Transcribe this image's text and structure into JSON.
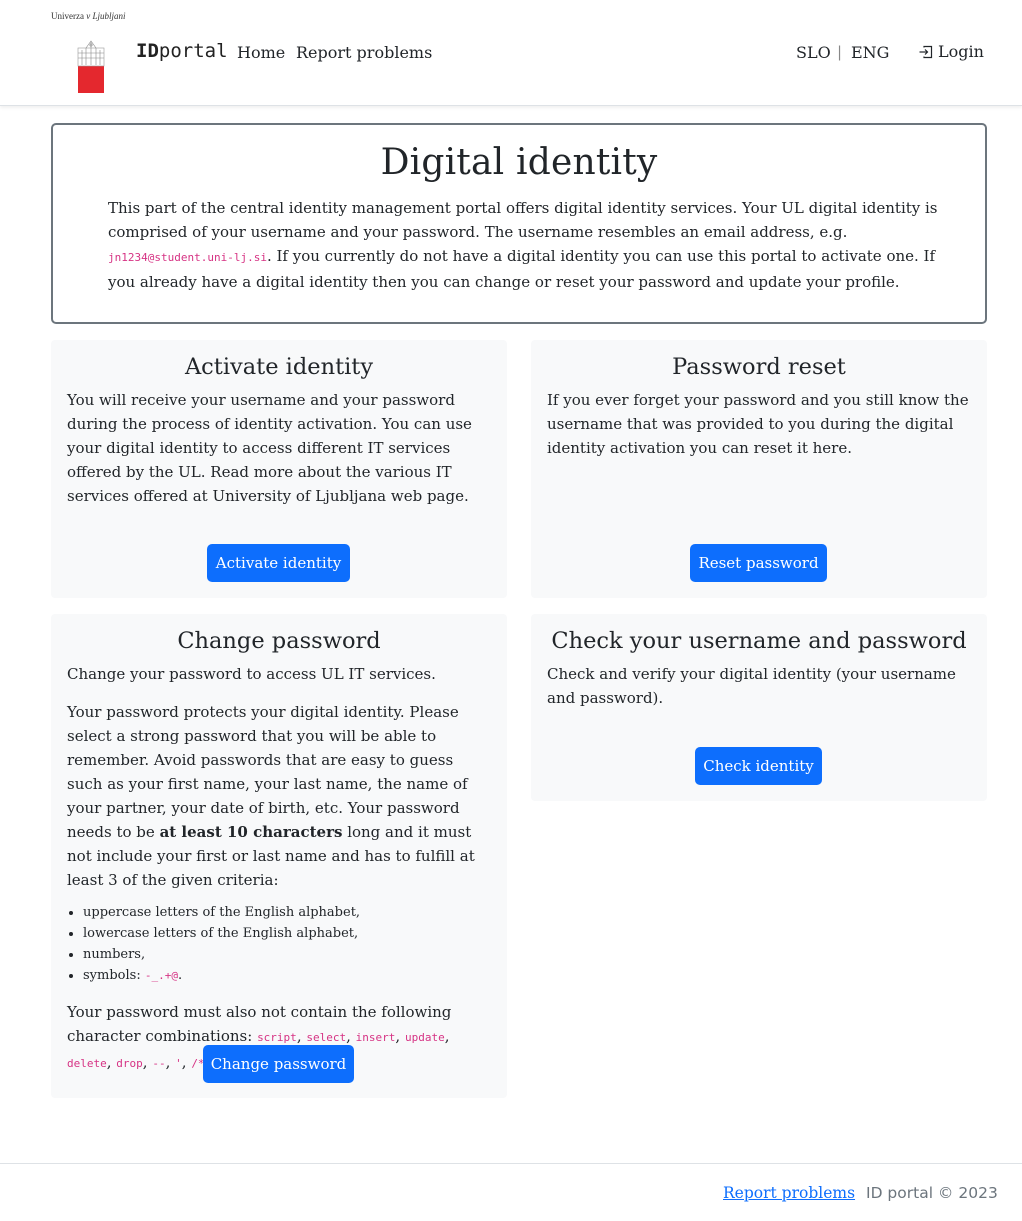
{
  "header": {
    "uni_name_prefix": "Univerza",
    "uni_name_suffix": "v Ljubljani",
    "brand_bold": "ID",
    "brand_rest": "portal",
    "nav": {
      "home": "Home",
      "report": "Report problems"
    },
    "lang": {
      "slo": "SLO",
      "sep": "|",
      "eng": "ENG"
    },
    "login": "Login"
  },
  "intro": {
    "title": "Digital identity",
    "text_1": "This part of the central identity management portal offers digital identity services. Your UL digital identity is comprised of your username and your password. The username resembles an email address, e.g. ",
    "example": "jn1234@student.uni-lj.si",
    "text_2": ". If you currently do not have a digital identity you can use this portal to activate one. If you already have a digital identity then you can change or reset your password and update your profile."
  },
  "cards": {
    "activate": {
      "title": "Activate identity",
      "desc": "You will receive your username and your password during the process of identity activation. You can use your digital identity to access different IT services offered by the UL. Read more about the various IT services offered at University of Ljubljana web page.",
      "button": "Activate identity"
    },
    "reset": {
      "title": "Password reset",
      "desc": "If you ever forget your password and you still know the username that was provided to you during the digital identity activation you can reset it here.",
      "button": "Reset password"
    },
    "change": {
      "title": "Change password",
      "desc": "Change your password to access UL IT services.",
      "policy_1": "Your password protects your digital identity. Please select a strong password that you will be able to remember. Avoid passwords that are easy to guess such as your first name, your last name, the name of your partner, your date of birth, etc. Your password needs to be ",
      "policy_bold": "at least 10 characters",
      "policy_2": " long and it must not include your first or last name and has to fulfill at least 3 of the given criteria:",
      "criteria": [
        "uppercase letters of the English alphabet,",
        "lowercase letters of the English alphabet,",
        "numbers,",
        "symbols: "
      ],
      "symbols": "-_.+@",
      "symbols_end": ".",
      "forbidden_intro": "Your password must also not contain the following character combinations: ",
      "forbidden": [
        "script",
        "select",
        "insert",
        "update",
        "delete",
        "drop",
        "--",
        "'",
        "/*",
        "*/"
      ],
      "forbidden_end": ".",
      "button": "Change password"
    },
    "check": {
      "title": "Check your username and password",
      "desc": "Check and verify your digital identity (your username and password).",
      "button": "Check identity"
    }
  },
  "footer": {
    "report": "Report problems",
    "copy": "ID portal © 2023"
  },
  "colors": {
    "primary": "#0d6efd",
    "card_bg": "#f8f9fa",
    "logo_red": "#e4282e",
    "code": "#d63384"
  }
}
